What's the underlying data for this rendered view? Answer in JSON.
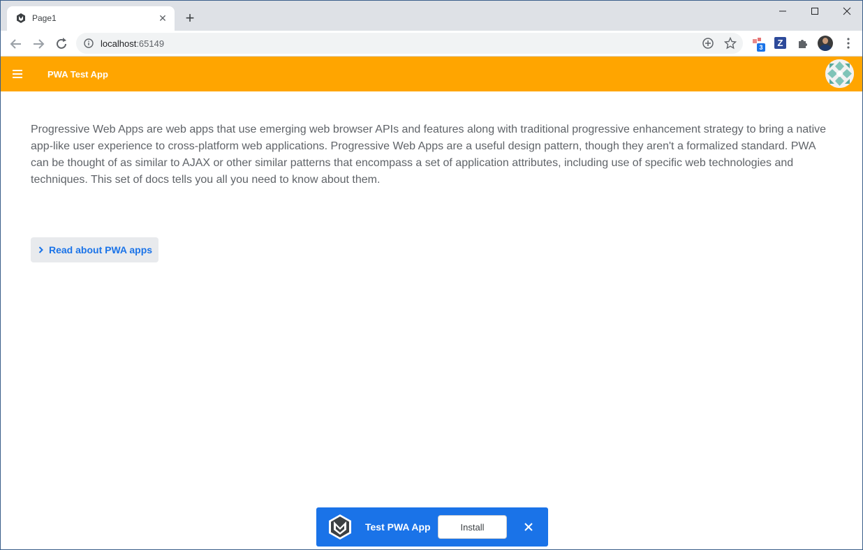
{
  "browser": {
    "tab": {
      "title": "Page1"
    },
    "new_tab_label": "+",
    "address_bar": {
      "host": "localhost",
      "port": ":65149"
    },
    "extensions": {
      "badge_count": "3",
      "z_label": "Z"
    }
  },
  "app": {
    "header": {
      "title": "PWA Test App"
    },
    "content": {
      "paragraph": "Progressive Web Apps are web apps that use emerging web browser APIs and features along with traditional progressive enhancement strategy to bring a native app-like user experience to cross-platform web applications. Progressive Web Apps are a useful design pattern, though they aren't a formalized standard. PWA can be thought of as similar to AJAX or other similar patterns that encompass a set of application attributes, including use of specific web technologies and techniques. This set of docs tells you all you need to know about them.",
      "read_button_label": "Read about PWA apps"
    },
    "install_banner": {
      "title": "Test PWA App",
      "install_label": "Install"
    }
  },
  "colors": {
    "header_bg": "#ffa500",
    "banner_bg": "#1a73e8",
    "link_blue": "#1a73e8"
  }
}
